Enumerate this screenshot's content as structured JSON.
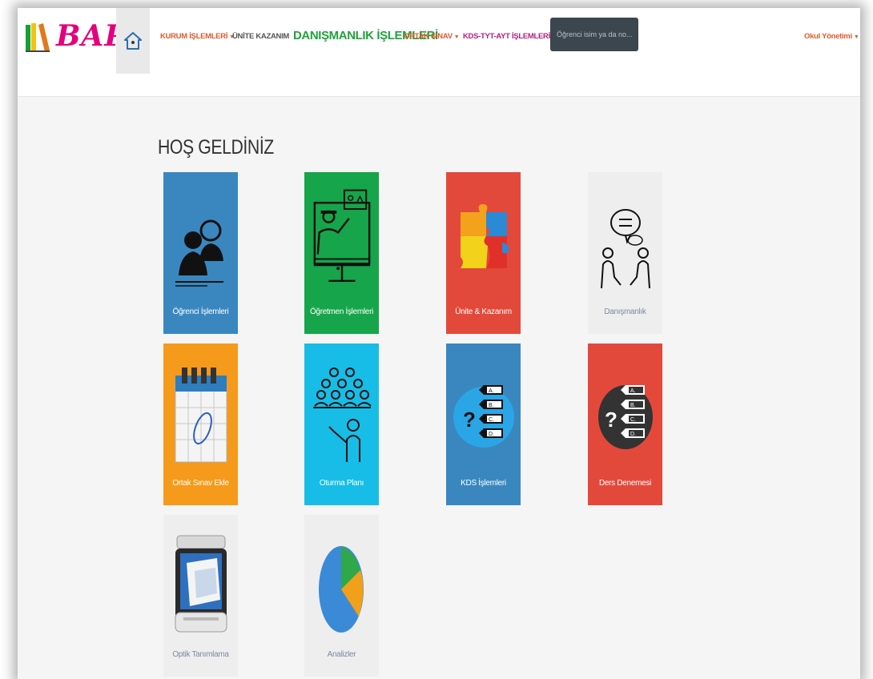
{
  "app": {
    "logo_text": "BAP"
  },
  "nav": {
    "home_icon": "home-icon",
    "items": [
      {
        "label": "KURUM İŞLEMLERİ",
        "dropdown": true,
        "color": "#e05a2b"
      },
      {
        "label": "ÜNİTE KAZANIM",
        "dropdown": false,
        "color": "#555555"
      },
      {
        "label": "DANIŞMANLIK İŞLEMLERİ",
        "dropdown": false,
        "color": "#1fa33a"
      },
      {
        "label": "ORTAK SINAV",
        "dropdown": true,
        "color": "#e05a2b"
      },
      {
        "label": "KDS-TYT-AYT İŞLEMLERİ",
        "dropdown": true,
        "color": "#b0207f"
      }
    ],
    "search_placeholder": "Öğrenci isim ya da no...",
    "user_menu": "Okul Yönetimi"
  },
  "main": {
    "title": "HOŞ GELDİNİZ",
    "tiles": [
      {
        "label": "Öğrenci İşlemleri",
        "icon": "students-icon",
        "bg": "#3a87c0"
      },
      {
        "label": "Öğretmen İşlemleri",
        "icon": "teacher-icon",
        "bg": "#16a54a"
      },
      {
        "label": "Ünite & Kazanım",
        "icon": "puzzle-icon",
        "bg": "#e3493b"
      },
      {
        "label": "Danışmanlık",
        "icon": "counseling-icon",
        "bg": "#eeeeee"
      },
      {
        "label": "Ortak Sınav Ekle",
        "icon": "calendar-icon",
        "bg": "#f59a1b"
      },
      {
        "label": "Oturma Planı",
        "icon": "seating-icon",
        "bg": "#17bde6"
      },
      {
        "label": "KDS İşlemleri",
        "icon": "quiz-icon",
        "bg": "#3a87c0"
      },
      {
        "label": "Ders Denemesi",
        "icon": "quiz-dark-icon",
        "bg": "#e3493b"
      },
      {
        "label": "Optik Tanımlama",
        "icon": "scanner-icon",
        "bg": "#eeeeee"
      },
      {
        "label": "Analizler",
        "icon": "pie-chart-icon",
        "bg": "#eeeeee"
      }
    ]
  }
}
